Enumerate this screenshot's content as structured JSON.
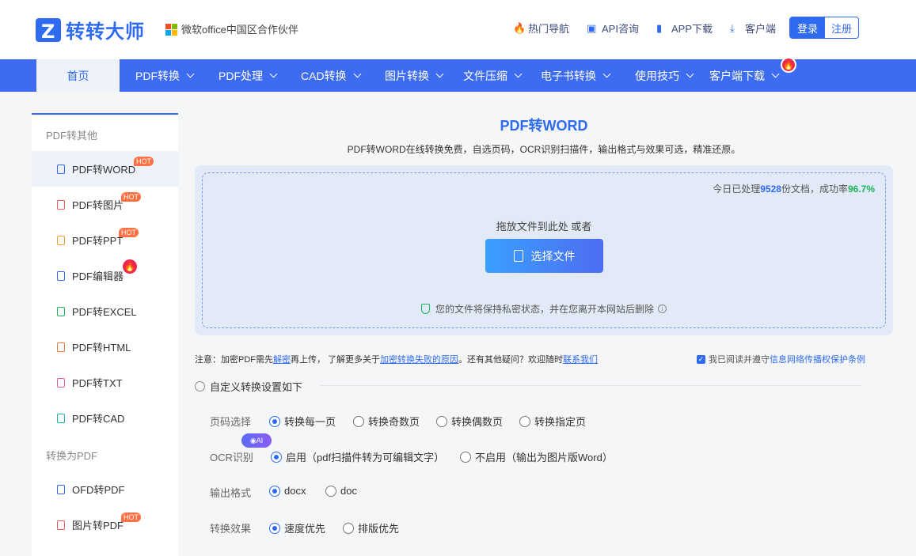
{
  "brand": {
    "name": "转转大师",
    "partner": "微软office中国区合作伙伴"
  },
  "top_links": [
    {
      "icon": "fire-icon",
      "label": "热门导航"
    },
    {
      "icon": "chat-icon",
      "label": "API咨询"
    },
    {
      "icon": "phone-icon",
      "label": "APP下载"
    },
    {
      "icon": "download-icon",
      "label": "客户端"
    }
  ],
  "auth": {
    "login": "登录",
    "register": "注册"
  },
  "nav": {
    "home": "首页",
    "items": [
      "PDF转换",
      "PDF处理",
      "CAD转换",
      "图片转换",
      "文件压缩",
      "电子书转换",
      "使用技巧",
      "客户端下载"
    ]
  },
  "sidebar": {
    "cat1": "PDF转其他",
    "items": [
      {
        "label": "PDF转WORD",
        "badge": "HOT",
        "color": "#2f6bf0"
      },
      {
        "label": "PDF转图片",
        "badge": "HOT",
        "color": "#f05a5a"
      },
      {
        "label": "PDF转PPT",
        "badge": "HOT",
        "color": "#f0a030"
      },
      {
        "label": "PDF编辑器",
        "badge": "",
        "color": "#2f6bf0"
      },
      {
        "label": "PDF转EXCEL",
        "badge": "",
        "color": "#19b45a"
      },
      {
        "label": "PDF转HTML",
        "badge": "",
        "color": "#f07a3a"
      },
      {
        "label": "PDF转TXT",
        "badge": "",
        "color": "#e05aa0"
      },
      {
        "label": "PDF转CAD",
        "badge": "",
        "color": "#19b4a0"
      }
    ],
    "cat2": "转换为PDF",
    "items2": [
      {
        "label": "OFD转PDF",
        "badge": "",
        "color": "#2f6bf0"
      },
      {
        "label": "图片转PDF",
        "badge": "HOT",
        "color": "#f05a5a"
      }
    ]
  },
  "main": {
    "title": "PDF转WORD",
    "subtitle": "PDF转WORD在线转换免费，自选页码，OCR识别扫描件，输出格式与效果可选，精准还原。",
    "stats_prefix": "今日已处理",
    "stats_count": "9528",
    "stats_mid": "份文档，成功率",
    "stats_rate": "96.7%",
    "drop_hint": "拖放文件到此处 或者",
    "choose_button": "选择文件",
    "privacy": "您的文件将保持私密状态，并在您离开本网站后删除"
  },
  "notice": {
    "p1": "注意：加密PDF需先",
    "link1": "解密",
    "p2": "再上传， 了解更多关于",
    "link2": "加密转换失败的原因",
    "p3": "。还有其他疑问？欢迎随时",
    "link3": "联系我们"
  },
  "agree": {
    "prefix": "我已阅读并遵守",
    "link": "信息网络传播权保护条例"
  },
  "settings": {
    "header": "自定义转换设置如下",
    "page_label": "页码选择",
    "page_opts": [
      "转换每一页",
      "转换奇数页",
      "转换偶数页",
      "转换指定页"
    ],
    "ocr_label": "OCR识别",
    "ocr_badge": "AI",
    "ocr_opts": [
      "启用（pdf扫描件转为可编辑文字）",
      "不启用（输出为图片版Word）"
    ],
    "format_label": "输出格式",
    "format_opts": [
      "docx",
      "doc"
    ],
    "effect_label": "转换效果",
    "effect_opts": [
      "速度优先",
      "排版优先"
    ]
  }
}
